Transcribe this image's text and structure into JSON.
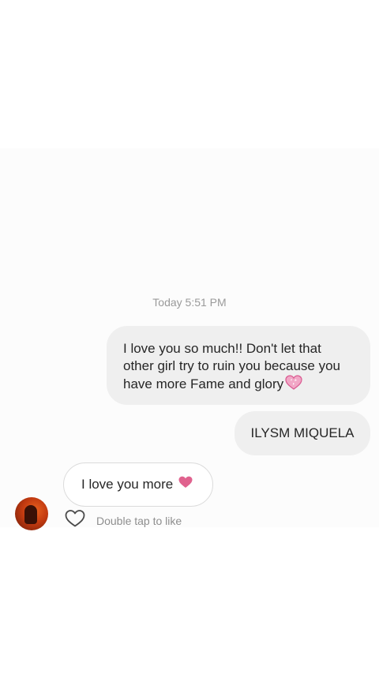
{
  "thread": {
    "timestamp": "Today 5:51 PM",
    "messages": [
      {
        "direction": "outgoing",
        "lines": [
          "I love you so much!! Don't let that",
          "other girl try to ruin you because you",
          "have more Fame and glory"
        ],
        "emoji": "sparkling-heart"
      },
      {
        "direction": "outgoing",
        "text": "ILYSM MIQUELA"
      },
      {
        "direction": "incoming",
        "text": "I love you more",
        "emoji": "heart"
      }
    ],
    "like_hint": "Double tap to like"
  },
  "colors": {
    "outgoing_bubble": "#efefef",
    "incoming_border": "#dbdbdb",
    "heart_pink": "#e0628e",
    "hint_gray": "#8e8e8e",
    "timestamp_gray": "#9a9a9a"
  },
  "icons": [
    "sparkling-heart-icon",
    "heart-icon",
    "like-heart-icon",
    "avatar"
  ]
}
